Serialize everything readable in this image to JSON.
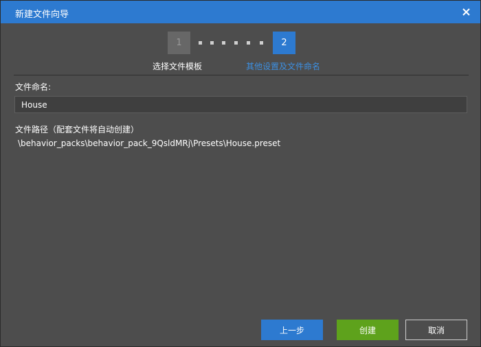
{
  "window": {
    "title": "新建文件向导",
    "close_icon": "close-icon"
  },
  "wizard": {
    "current_step": 2,
    "steps": [
      {
        "number": "1",
        "label": "选择文件模板"
      },
      {
        "number": "2",
        "label": "其他设置及文件命名"
      }
    ]
  },
  "form": {
    "name_label": "文件命名:",
    "name_value": "House",
    "path_label": "文件路径（配套文件将自动创建）",
    "path_value": "\\behavior_packs\\behavior_pack_9QsldMRj\\Presets\\House.preset"
  },
  "buttons": {
    "prev": "上一步",
    "create": "创建",
    "cancel": "取消"
  },
  "colors": {
    "titlebar": "#2d7ad0",
    "active_step": "#2d7ad0",
    "create_button": "#5ea21c",
    "active_label": "#3d8fe0"
  }
}
